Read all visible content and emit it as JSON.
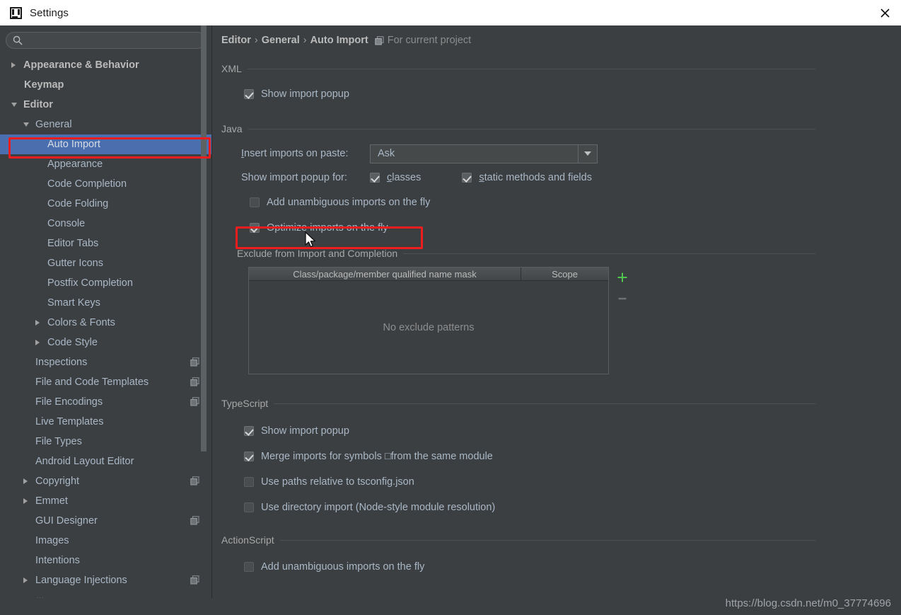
{
  "window": {
    "title": "Settings",
    "logo_icon": "intellij-idea-logo",
    "close_icon": "close-icon"
  },
  "sidebar": {
    "search": {
      "value": "",
      "placeholder": "",
      "icon": "search-icon"
    },
    "items": [
      {
        "label": "Appearance & Behavior",
        "indent": 16,
        "arrow": "collapsed",
        "bold": true,
        "selected": false,
        "badge": false
      },
      {
        "label": "Keymap",
        "indent": 34,
        "arrow": "none",
        "bold": true,
        "selected": false,
        "badge": false
      },
      {
        "label": "Editor",
        "indent": 16,
        "arrow": "expanded",
        "bold": true,
        "selected": false,
        "badge": false
      },
      {
        "label": "General",
        "indent": 33,
        "arrow": "expanded",
        "bold": false,
        "selected": false,
        "badge": false
      },
      {
        "label": "Auto Import",
        "indent": 67,
        "arrow": "none",
        "bold": false,
        "selected": true,
        "badge": false
      },
      {
        "label": "Appearance",
        "indent": 67,
        "arrow": "none",
        "bold": false,
        "selected": false,
        "badge": false
      },
      {
        "label": "Code Completion",
        "indent": 67,
        "arrow": "none",
        "bold": false,
        "selected": false,
        "badge": false
      },
      {
        "label": "Code Folding",
        "indent": 67,
        "arrow": "none",
        "bold": false,
        "selected": false,
        "badge": false
      },
      {
        "label": "Console",
        "indent": 67,
        "arrow": "none",
        "bold": false,
        "selected": false,
        "badge": false
      },
      {
        "label": "Editor Tabs",
        "indent": 67,
        "arrow": "none",
        "bold": false,
        "selected": false,
        "badge": false
      },
      {
        "label": "Gutter Icons",
        "indent": 67,
        "arrow": "none",
        "bold": false,
        "selected": false,
        "badge": false
      },
      {
        "label": "Postfix Completion",
        "indent": 67,
        "arrow": "none",
        "bold": false,
        "selected": false,
        "badge": false
      },
      {
        "label": "Smart Keys",
        "indent": 67,
        "arrow": "none",
        "bold": false,
        "selected": false,
        "badge": false
      },
      {
        "label": "Colors & Fonts",
        "indent": 50,
        "arrow": "collapsed",
        "bold": false,
        "selected": false,
        "badge": false
      },
      {
        "label": "Code Style",
        "indent": 50,
        "arrow": "collapsed",
        "bold": false,
        "selected": false,
        "badge": false
      },
      {
        "label": "Inspections",
        "indent": 50,
        "arrow": "none",
        "bold": false,
        "selected": false,
        "badge": true
      },
      {
        "label": "File and Code Templates",
        "indent": 50,
        "arrow": "none",
        "bold": false,
        "selected": false,
        "badge": true
      },
      {
        "label": "File Encodings",
        "indent": 50,
        "arrow": "none",
        "bold": false,
        "selected": false,
        "badge": true
      },
      {
        "label": "Live Templates",
        "indent": 50,
        "arrow": "none",
        "bold": false,
        "selected": false,
        "badge": false
      },
      {
        "label": "File Types",
        "indent": 50,
        "arrow": "none",
        "bold": false,
        "selected": false,
        "badge": false
      },
      {
        "label": "Android Layout Editor",
        "indent": 50,
        "arrow": "none",
        "bold": false,
        "selected": false,
        "badge": false
      },
      {
        "label": "Copyright",
        "indent": 33,
        "arrow": "collapsed",
        "bold": false,
        "selected": false,
        "badge": true
      },
      {
        "label": "Emmet",
        "indent": 33,
        "arrow": "collapsed",
        "bold": false,
        "selected": false,
        "badge": false
      },
      {
        "label": "GUI Designer",
        "indent": 50,
        "arrow": "none",
        "bold": false,
        "selected": false,
        "badge": true
      },
      {
        "label": "Images",
        "indent": 50,
        "arrow": "none",
        "bold": false,
        "selected": false,
        "badge": false
      },
      {
        "label": "Intentions",
        "indent": 50,
        "arrow": "none",
        "bold": false,
        "selected": false,
        "badge": false
      },
      {
        "label": "Language Injections",
        "indent": 33,
        "arrow": "collapsed",
        "bold": false,
        "selected": false,
        "badge": true
      }
    ],
    "partial_next_item": "..."
  },
  "breadcrumb": {
    "path": [
      "Editor",
      "General",
      "Auto Import"
    ],
    "separator": "›",
    "project_icon": "project-scope-icon",
    "project_scope_text": "For current project"
  },
  "sections": {
    "xml": {
      "title": "XML",
      "options": [
        {
          "label": "Show import popup",
          "checked": true
        }
      ]
    },
    "java": {
      "title": "Java",
      "insert_imports_label": "Insert imports on paste:",
      "insert_imports_mnemonic": "I",
      "insert_imports_value": "Ask",
      "insert_imports_options": [
        "Ask"
      ],
      "show_popup_label": "Show import popup for:",
      "show_popup_checkboxes": [
        {
          "label": "classes",
          "mnemonic": "c",
          "checked": true
        },
        {
          "label": "static methods and fields",
          "mnemonic": "s",
          "checked": true
        }
      ],
      "options": [
        {
          "label": "Add unambiguous imports on the fly",
          "checked": false,
          "highlighted": false
        },
        {
          "label": "Optimize imports on the fly",
          "checked": true,
          "highlighted": true
        }
      ],
      "exclude": {
        "title": "Exclude from Import and Completion",
        "columns": [
          "Class/package/member qualified name mask",
          "Scope"
        ],
        "rows": [],
        "empty_text": "No exclude patterns",
        "add_button": "+",
        "remove_button": "—"
      }
    },
    "typescript": {
      "title": "TypeScript",
      "options": [
        {
          "label": "Show import popup",
          "checked": true
        },
        {
          "label": "Merge imports for symbols □from the same module",
          "checked": true
        },
        {
          "label": "Use paths relative to tsconfig.json",
          "checked": false
        },
        {
          "label": "Use directory import (Node-style module resolution)",
          "checked": false
        }
      ]
    },
    "actionscript": {
      "title": "ActionScript",
      "options": [
        {
          "label": "Add unambiguous imports on the fly",
          "checked": false
        }
      ]
    }
  },
  "annotations": {
    "color": "#ef1d1d",
    "boxes": [
      "sidebar-auto-import",
      "optimize-imports-on-the-fly"
    ]
  },
  "watermark": "https://blog.csdn.net/m0_37774696",
  "colors": {
    "background": "#3c3f41",
    "titlebar": "#ffffff",
    "selection": "#4b6eaf",
    "text": "#a9b7c6",
    "accent_add": "#4ec94e",
    "annotation": "#ef1d1d"
  }
}
